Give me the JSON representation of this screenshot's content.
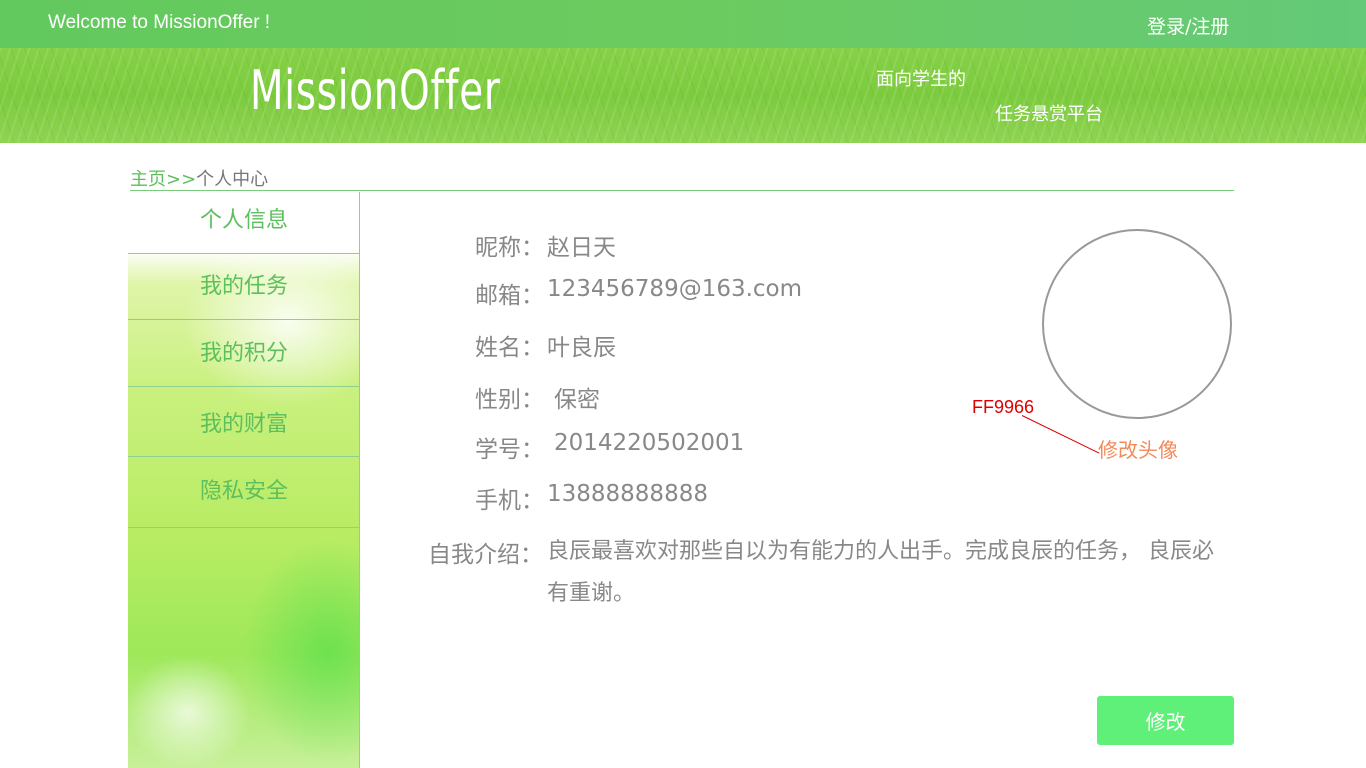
{
  "header": {
    "welcome": "Welcome to MissionOffer !",
    "login_register": "登录/注册"
  },
  "banner": {
    "logo": "MissionOffer",
    "slogan_line1": "面向学生的",
    "slogan_line2": "任务悬赏平台"
  },
  "breadcrumb": {
    "home": "主页",
    "separator": ">>",
    "current": "个人中心"
  },
  "sidebar": {
    "items": [
      {
        "label": "个人信息"
      },
      {
        "label": "我的任务"
      },
      {
        "label": "我的积分"
      },
      {
        "label": "我的财富"
      },
      {
        "label": "隐私安全"
      }
    ]
  },
  "profile": {
    "nickname_label": "昵称：",
    "nickname": "赵日天",
    "email_label": "邮箱：",
    "email": "123456789@163.com",
    "name_label": "姓名：",
    "name": "叶良辰",
    "gender_label": "性别：",
    "gender": "保密",
    "student_id_label": "学号：",
    "student_id": "2014220502001",
    "phone_label": "手机：",
    "phone": "13888888888",
    "intro_label": "自我介绍：",
    "intro": "良辰最喜欢对那些自以为有能力的人出手。完成良辰的任务， 良辰必有重谢。"
  },
  "avatar": {
    "color_note": "FF9966",
    "edit_label": "修改头像"
  },
  "actions": {
    "edit_label": "修改"
  },
  "colors": {
    "accent_green": "#5cbf5c",
    "button_green": "#5ff07a",
    "edit_avatar_orange": "#f28a5a",
    "annotation_red": "#dd0000"
  }
}
